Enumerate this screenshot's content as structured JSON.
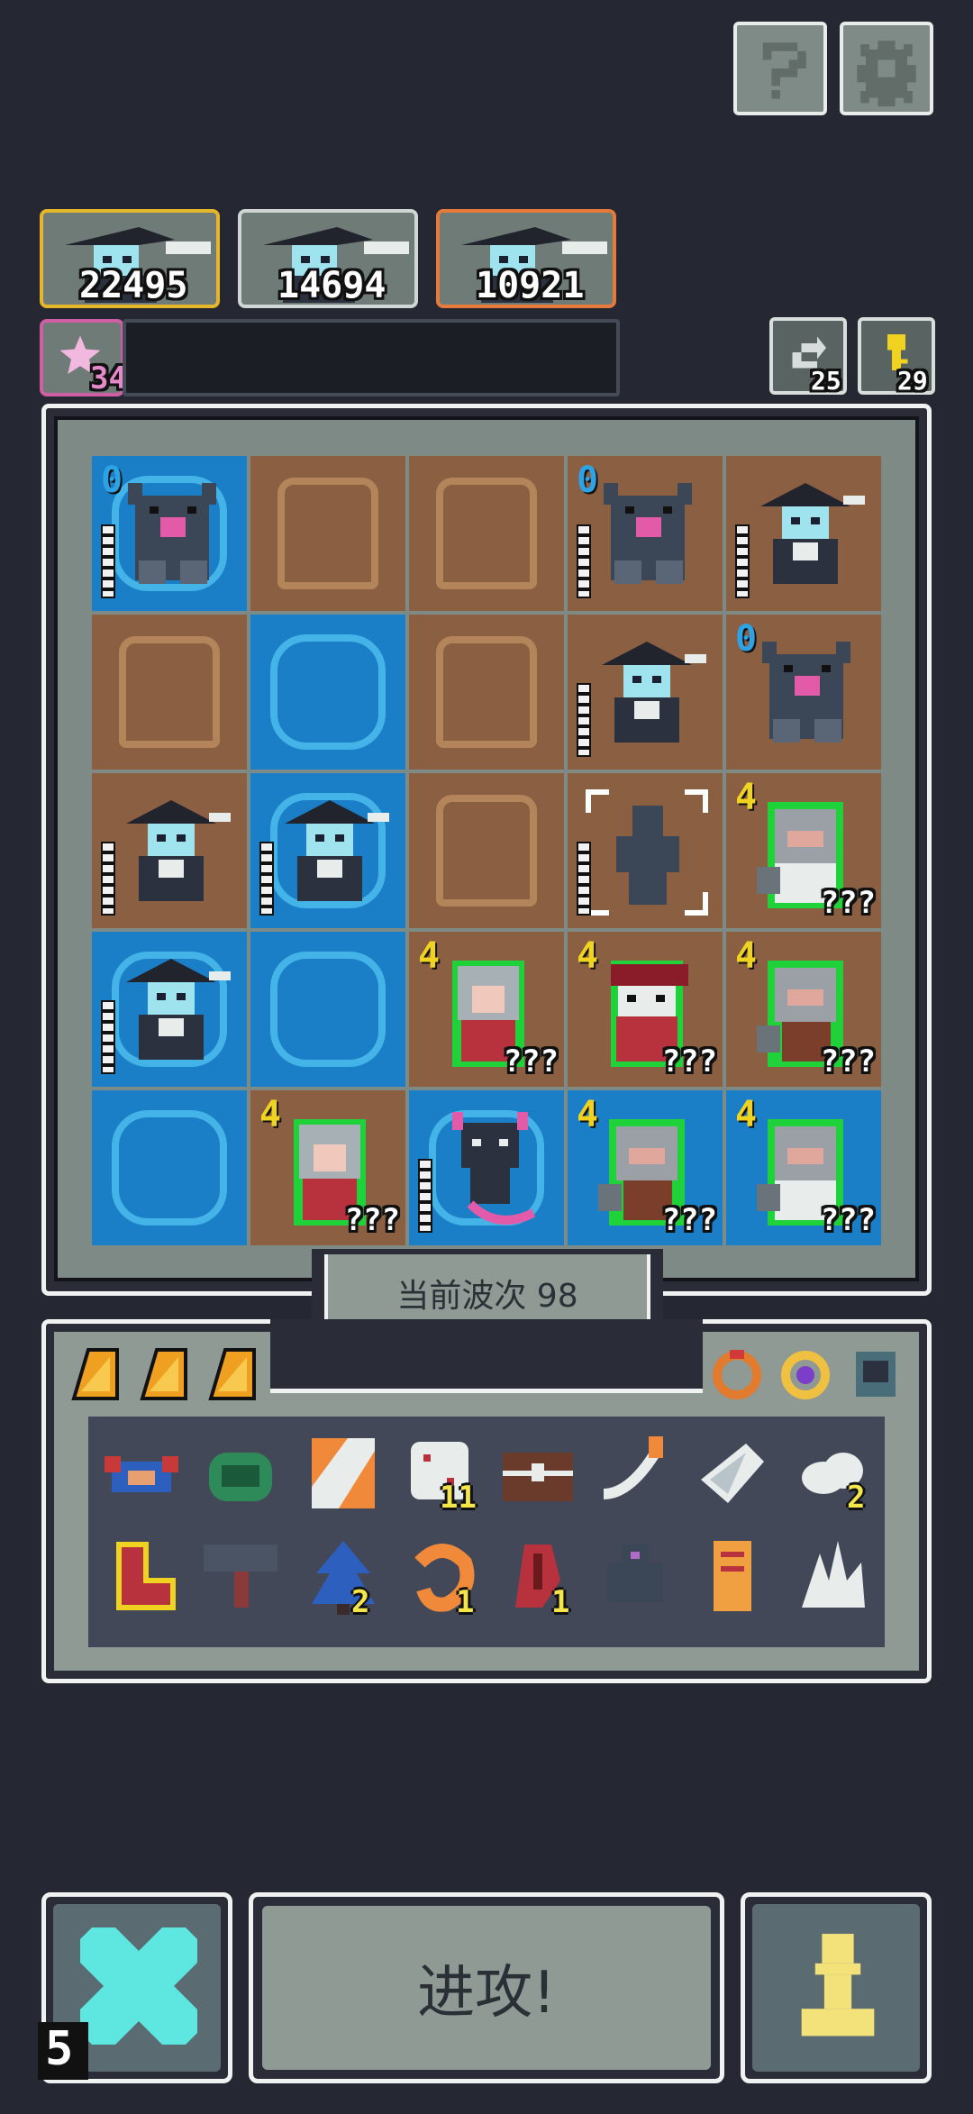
{
  "top_buttons": {
    "help_icon": "question-icon",
    "settings_icon": "gear-icon"
  },
  "heroes": [
    {
      "value": "22495",
      "border": "#e6b62a"
    },
    {
      "value": "14694",
      "border": "#cfd6d3"
    },
    {
      "value": "10921",
      "border": "#e57a3a"
    }
  ],
  "star": {
    "count": "34",
    "color": "#d05ea4"
  },
  "resources": [
    {
      "icon": "refresh-icon",
      "count": "25"
    },
    {
      "icon": "key-icon",
      "count": "29"
    }
  ],
  "board": {
    "rows": [
      [
        {
          "tile": "water",
          "unit": "golem",
          "level": "0"
        },
        {
          "tile": "ground"
        },
        {
          "tile": "ground"
        },
        {
          "tile": "ground",
          "unit": "golem",
          "level": "0"
        },
        {
          "tile": "ground",
          "unit": "ronin"
        }
      ],
      [
        {
          "tile": "ground"
        },
        {
          "tile": "water"
        },
        {
          "tile": "ground"
        },
        {
          "tile": "ground",
          "unit": "ronin"
        },
        {
          "tile": "ground",
          "unit": "golem",
          "level": "0"
        }
      ],
      [
        {
          "tile": "ground",
          "unit": "ronin"
        },
        {
          "tile": "water",
          "unit": "ronin"
        },
        {
          "tile": "ground"
        },
        {
          "tile": "ground",
          "unit": "statue"
        },
        {
          "tile": "ground",
          "unit": "knight",
          "level": "4",
          "hidden": "???"
        }
      ],
      [
        {
          "tile": "water",
          "unit": "ronin"
        },
        {
          "tile": "water"
        },
        {
          "tile": "ground",
          "unit": "girl",
          "level": "4",
          "hidden": "???"
        },
        {
          "tile": "ground",
          "unit": "mage",
          "level": "4",
          "hidden": "???"
        },
        {
          "tile": "ground",
          "unit": "knight",
          "level": "4",
          "hidden": "???"
        }
      ],
      [
        {
          "tile": "water"
        },
        {
          "tile": "ground",
          "unit": "girl",
          "level": "4",
          "hidden": "???"
        },
        {
          "tile": "water",
          "unit": "dragon"
        },
        {
          "tile": "water",
          "unit": "knight",
          "level": "4",
          "hidden": "???"
        },
        {
          "tile": "water",
          "unit": "knight",
          "level": "4",
          "hidden": "???"
        }
      ]
    ]
  },
  "wave": {
    "label": "当前波次 98"
  },
  "inventory": {
    "tabs": [
      "cheese-icon",
      "cheese-icon",
      "cheese-icon"
    ],
    "rings": [
      "orange-ring-icon",
      "purple-ring-icon",
      "blue-amulet-icon"
    ],
    "row1": [
      {
        "icon": "crab-icon",
        "count": ""
      },
      {
        "icon": "shell-icon",
        "count": ""
      },
      {
        "icon": "flag-icon",
        "count": ""
      },
      {
        "icon": "dice-icon",
        "count": "11"
      },
      {
        "icon": "chest-icon",
        "count": ""
      },
      {
        "icon": "feather-knife-icon",
        "count": ""
      },
      {
        "icon": "wing-icon",
        "count": ""
      },
      {
        "icon": "cloud-icon",
        "count": "2"
      }
    ],
    "row2": [
      {
        "icon": "sock-icon",
        "count": ""
      },
      {
        "icon": "hammer-icon",
        "count": ""
      },
      {
        "icon": "tree-icon",
        "count": "2"
      },
      {
        "icon": "shrimp-icon",
        "count": "1"
      },
      {
        "icon": "claw-icon",
        "count": "1"
      },
      {
        "icon": "beast-icon",
        "count": ""
      },
      {
        "icon": "scroll-icon",
        "count": ""
      },
      {
        "icon": "crystal-icon",
        "count": ""
      }
    ]
  },
  "bottom": {
    "left_count": "5",
    "attack_label": "进攻!",
    "left_icon": "crossed-swords-icon",
    "right_icon": "pawn-icon",
    "accent": "#5ee6e0",
    "pawn_color": "#f3e27a"
  }
}
